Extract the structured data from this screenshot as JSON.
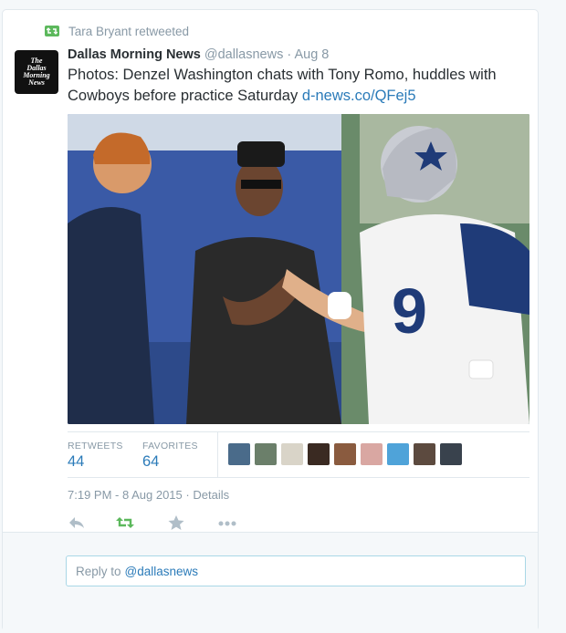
{
  "context": {
    "retweeted_by": "Tara Bryant retweeted"
  },
  "tweet": {
    "avatar_text_lines": [
      "The",
      "Dallas",
      "Morning",
      "News"
    ],
    "name": "Dallas Morning News",
    "handle": "@dallasnews",
    "separator": "·",
    "date": "Aug 8",
    "text": "Photos: Denzel Washington chats with Tony Romo, huddles with Cowboys before practice Saturday ",
    "link": "d-news.co/QFej5"
  },
  "stats": {
    "retweets_label": "RETWEETS",
    "retweets_value": "44",
    "favorites_label": "FAVORITES",
    "favorites_value": "64",
    "face_colors": [
      "#4a6b8a",
      "#6b7f6a",
      "#d9d4c8",
      "#3a2a22",
      "#8a5b3f",
      "#d9a7a2",
      "#4fa3d9",
      "#5c4a3f",
      "#39424d"
    ]
  },
  "timestamp": {
    "time": "7:19 PM - 8 Aug 2015",
    "separator": "·",
    "details": "Details"
  },
  "actions": {
    "reply_icon": "reply-icon",
    "retweet_icon": "retweet-icon",
    "favorite_icon": "star-icon",
    "more_icon": "more-icon"
  },
  "reply": {
    "prefix": "Reply to",
    "handle": "@dallasnews"
  },
  "colors": {
    "link": "#2b7bb9",
    "retweet_green": "#5cb85c",
    "muted": "#8899a6"
  }
}
